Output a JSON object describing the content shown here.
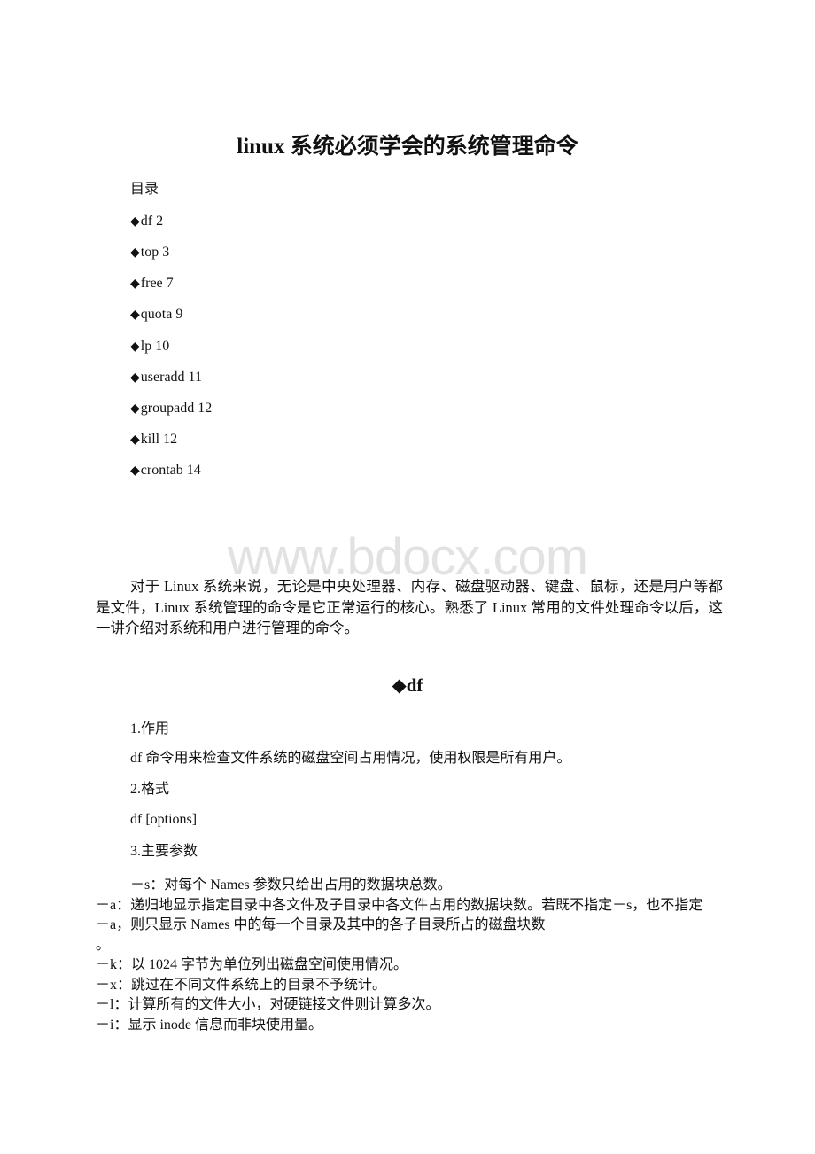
{
  "document": {
    "title": "linux 系统必须学会的系统管理命令",
    "toc": {
      "heading": "目录",
      "bullet": "◆",
      "items": [
        {
          "label": "df 2"
        },
        {
          "label": "top 3"
        },
        {
          "label": "free 7"
        },
        {
          "label": "quota 9"
        },
        {
          "label": "lp 10"
        },
        {
          "label": "useradd 11"
        },
        {
          "label": "groupadd 12"
        },
        {
          "label": "kill 12"
        },
        {
          "label": "crontab 14"
        }
      ]
    },
    "watermark": "www.bdocx.com",
    "intro": "对于 Linux 系统来说，无论是中央处理器、内存、磁盘驱动器、键盘、鼠标，还是用户等都是文件，Linux 系统管理的命令是它正常运行的核心。熟悉了 Linux 常用的文件处理命令以后，这一讲介绍对系统和用户进行管理的命令。",
    "section_df": {
      "heading": "◆df",
      "purpose_heading": "1.作用",
      "purpose_text": "df 命令用来检查文件系统的磁盘空间占用情况，使用权限是所有用户。",
      "format_heading": "2.格式",
      "format_text": "df [options]",
      "params_heading": "3.主要参数",
      "params": [
        "－s：对每个 Names 参数只给出占用的数据块总数。",
        "－a：递归地显示指定目录中各文件及子目录中各文件占用的数据块数。若既不指定－s，也不指定－a，则只显示 Names 中的每一个目录及其中的各子目录所占的磁盘块数",
        "。",
        "－k：以 1024 字节为单位列出磁盘空间使用情况。",
        "－x：跳过在不同文件系统上的目录不予统计。",
        "－l：计算所有的文件大小，对硬链接文件则计算多次。",
        "－i：显示 inode 信息而非块使用量。"
      ]
    }
  }
}
